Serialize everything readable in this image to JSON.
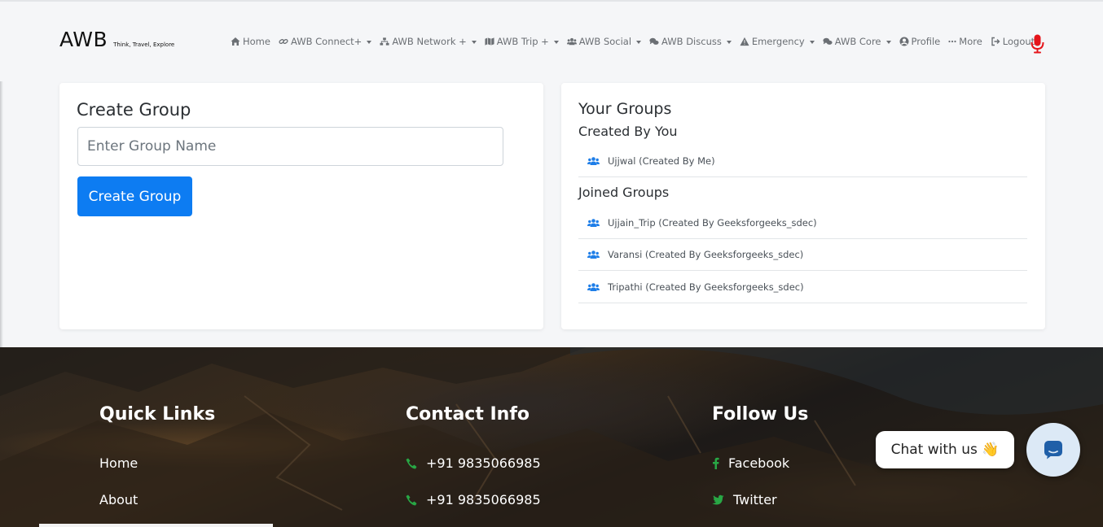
{
  "brand": {
    "name": "AWB",
    "tagline": "Think, Travel, Explore"
  },
  "nav": {
    "items": [
      {
        "label": "Home",
        "icon": "home-icon",
        "dropdown": false
      },
      {
        "label": "AWB Connect+",
        "icon": "link-icon",
        "dropdown": true
      },
      {
        "label": "AWB Network +",
        "icon": "sitemap-icon",
        "dropdown": true
      },
      {
        "label": "AWB Trip +",
        "icon": "map-icon",
        "dropdown": true
      },
      {
        "label": "AWB Social",
        "icon": "users-icon",
        "dropdown": true
      },
      {
        "label": "AWB Discuss",
        "icon": "comments-icon",
        "dropdown": true
      },
      {
        "label": "Emergency",
        "icon": "warning-icon",
        "dropdown": true
      },
      {
        "label": "AWB Core",
        "icon": "comments-icon",
        "dropdown": true
      },
      {
        "label": "Profile",
        "icon": "user-circle-icon",
        "dropdown": false
      },
      {
        "label": "More",
        "icon": "ellipsis-icon",
        "dropdown": false
      },
      {
        "label": "Logout",
        "icon": "logout-icon",
        "dropdown": false
      }
    ],
    "mic_icon": "microphone-icon"
  },
  "create_group": {
    "title": "Create Group",
    "input_placeholder": "Enter Group Name",
    "input_value": "",
    "button_label": "Create Group"
  },
  "your_groups": {
    "title": "Your Groups",
    "created_heading": "Created By You",
    "created": [
      {
        "label": "Ujjwal (Created By Me)"
      }
    ],
    "joined_heading": "Joined Groups",
    "joined": [
      {
        "label": "Ujjain_Trip (Created By Geeksforgeeks_sdec)"
      },
      {
        "label": "Varansi (Created By Geeksforgeeks_sdec)"
      },
      {
        "label": "Tripathi (Created By Geeksforgeeks_sdec)"
      }
    ]
  },
  "footer": {
    "quick_links": {
      "title": "Quick Links",
      "items": [
        "Home",
        "About"
      ]
    },
    "contact": {
      "title": "Contact Info",
      "phones": [
        "+91 9835066985",
        "+91 9835066985"
      ]
    },
    "follow": {
      "title": "Follow Us",
      "items": [
        {
          "label": "Facebook",
          "icon": "facebook-icon"
        },
        {
          "label": "Twitter",
          "icon": "twitter-icon"
        }
      ]
    }
  },
  "chat": {
    "bubble_text": "Chat with us 👋",
    "button_icon": "chat-icon"
  },
  "colors": {
    "primary": "#0d7cf2",
    "nav_text": "#6b6f74",
    "mic": "#e5151b",
    "footer_icon_green": "#28a745",
    "chat_button_bg": "#dce9f6",
    "chat_icon": "#1f5fa8"
  }
}
